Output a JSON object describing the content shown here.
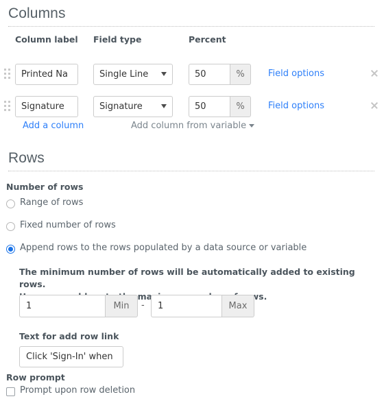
{
  "columns_section": {
    "heading": "Columns",
    "headers": {
      "column_label": "Column label",
      "field_type": "Field type",
      "percent": "Percent"
    },
    "rows": [
      {
        "drag_handle": "drag-handle-icon",
        "label_value": "Printed Na",
        "field_type_value": "Single Line",
        "percent_value": "50",
        "percent_unit": "%",
        "field_options_label": "Field options",
        "remove_icon": "close-icon"
      },
      {
        "drag_handle": "drag-handle-icon",
        "label_value": "Signature",
        "field_type_value": "Signature",
        "percent_value": "50",
        "percent_unit": "%",
        "field_options_label": "Field options",
        "remove_icon": "close-icon"
      }
    ],
    "add_column_label": "Add a column",
    "add_column_from_variable_label": "Add column from variable"
  },
  "rows_section": {
    "heading": "Rows",
    "number_of_rows_label": "Number of rows",
    "options": [
      {
        "label": "Range of rows",
        "selected": false
      },
      {
        "label": "Fixed number of rows",
        "selected": false
      },
      {
        "label": "Append rows to the rows populated by a data source or variable",
        "selected": true
      }
    ],
    "description_line1": "The minimum number of rows will be automatically added to existing rows.",
    "description_line2": "Users can add up to the maximum number of rows.",
    "min_value": "1",
    "min_addon": "Min",
    "separator": "-",
    "max_value": "1",
    "max_addon": "Max",
    "add_row_link_label": "Text for add row link",
    "add_row_link_value": "Click 'Sign-In' when",
    "row_prompt_label": "Row prompt",
    "prompt_on_delete_label": "Prompt upon row deletion",
    "prompt_on_delete_checked": false
  },
  "colors": {
    "link": "#2d7ff9",
    "accent": "#1a73e8",
    "heading": "#555f66",
    "text": "#5a646c",
    "addon_bg": "#eeeeee"
  }
}
